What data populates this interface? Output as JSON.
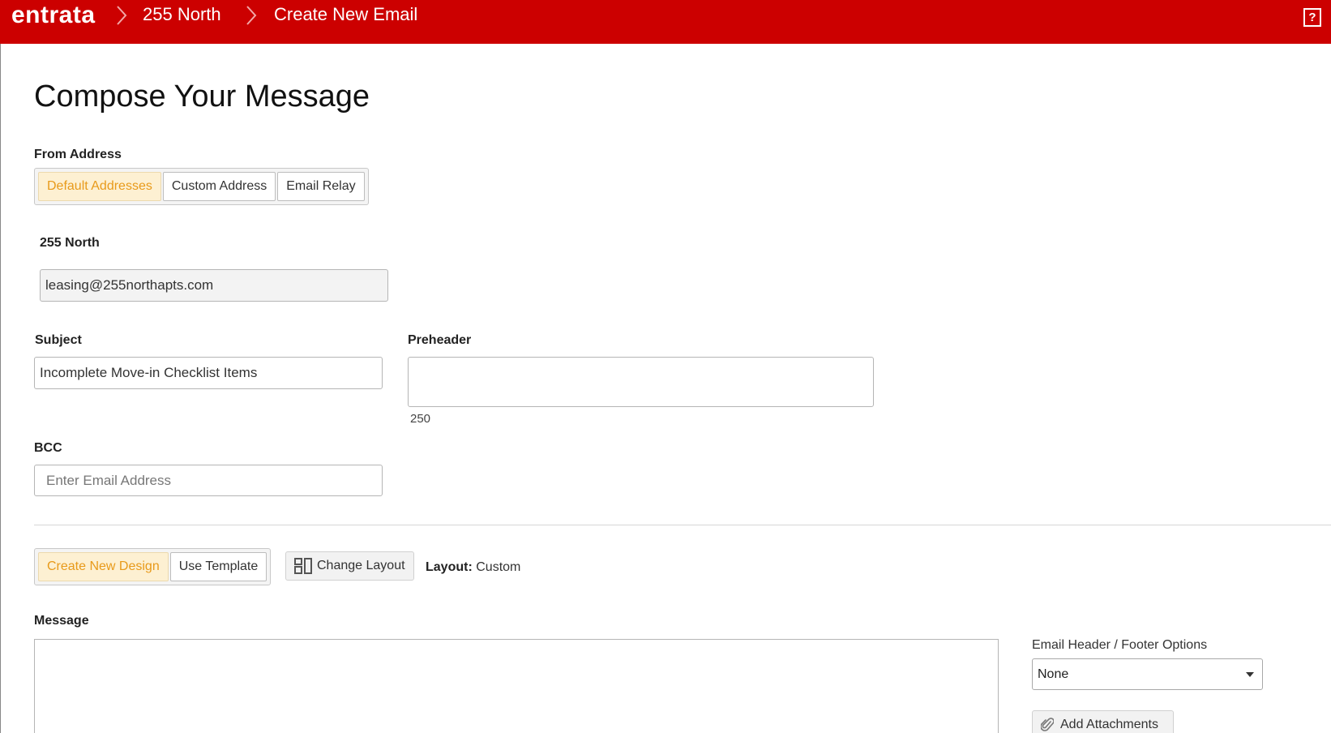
{
  "header": {
    "logo": "entrata",
    "breadcrumbs": [
      "255 North",
      "Create New Email"
    ],
    "help_label": "?"
  },
  "page": {
    "title": "Compose Your Message"
  },
  "from_address": {
    "label": "From Address",
    "tabs": [
      {
        "label": "Default Addresses",
        "active": true
      },
      {
        "label": "Custom Address",
        "active": false
      },
      {
        "label": "Email Relay",
        "active": false
      }
    ],
    "property_label": "255 North",
    "email_value": "leasing@255northapts.com"
  },
  "subject": {
    "label": "Subject",
    "value": "Incomplete Move-in Checklist Items"
  },
  "preheader": {
    "label": "Preheader",
    "value": "",
    "char_count": "250"
  },
  "bcc": {
    "label": "BCC",
    "placeholder": "Enter Email Address"
  },
  "design": {
    "tabs": [
      {
        "label": "Create New Design",
        "active": true
      },
      {
        "label": "Use Template",
        "active": false
      }
    ],
    "change_layout_label": "Change Layout",
    "layout_label": "Layout:",
    "layout_value": "Custom"
  },
  "message": {
    "label": "Message"
  },
  "options": {
    "header_footer_label": "Email Header / Footer Options",
    "header_footer_value": "None",
    "add_attachments_label": "Add Attachments"
  },
  "colors": {
    "brand_red": "#cc0000",
    "active_tab_bg": "#fdf0d2",
    "active_tab_text": "#e89a1a"
  },
  "icons": [
    "chevron-right-icon",
    "help-icon",
    "layout-icon",
    "paperclip-icon",
    "caret-down-icon"
  ]
}
